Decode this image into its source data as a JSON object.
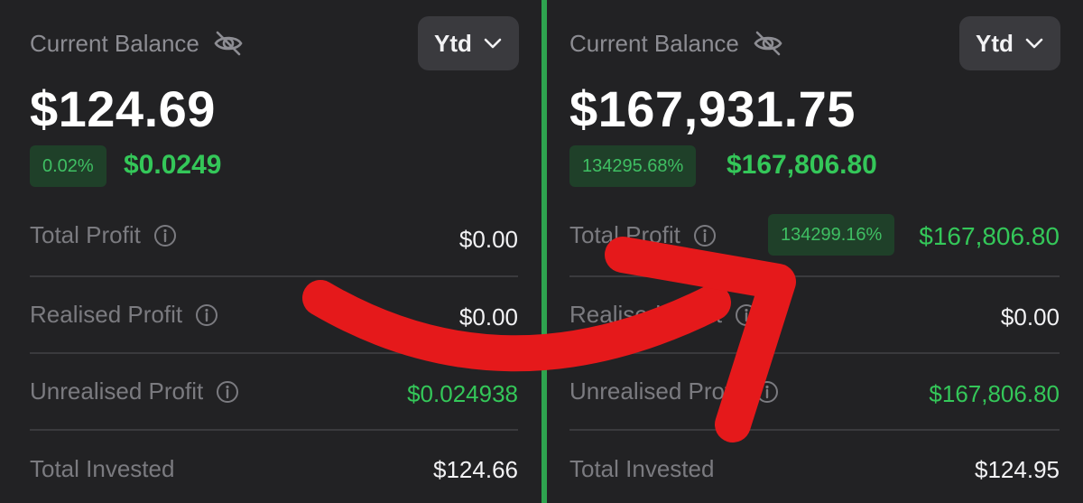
{
  "left": {
    "balance_label": "Current Balance",
    "period": "Ytd",
    "balance": "$124.69",
    "change_pct": "0.02%",
    "change_amount": "$0.0249",
    "rows": [
      {
        "label": "Total Profit",
        "value": "$0.00"
      },
      {
        "label": "Realised Profit",
        "value": "$0.00"
      },
      {
        "label": "Unrealised Profit",
        "value": "$0.024938"
      },
      {
        "label": "Total Invested",
        "value": "$124.66"
      }
    ]
  },
  "right": {
    "balance_label": "Current Balance",
    "period": "Ytd",
    "balance": "$167,931.75",
    "change_pct": "134295.68%",
    "change_amount": "$167,806.80",
    "rows": [
      {
        "label": "Total Profit",
        "badge": "134299.16%",
        "value": "$167,806.80"
      },
      {
        "label": "Realised Profit",
        "value": "$0.00"
      },
      {
        "label": "Unrealised Profit",
        "value": "$167,806.80"
      },
      {
        "label": "Total Invested",
        "value": "$124.95"
      }
    ]
  },
  "colors": {
    "background": "#222224",
    "positive": "#34c759",
    "divider": "#2ea44f",
    "arrow": "#e5191b"
  },
  "icons": [
    "eye-off-icon",
    "chevron-down-icon",
    "info-icon",
    "curved-arrow-icon"
  ]
}
